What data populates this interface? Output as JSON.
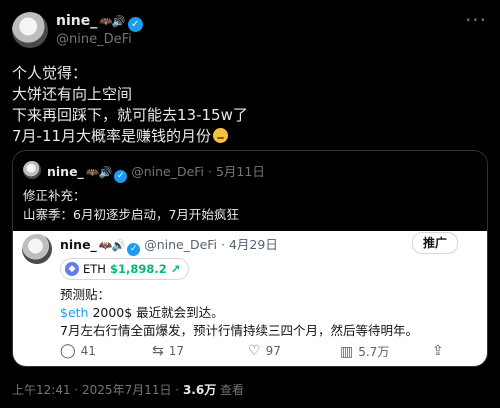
{
  "post": {
    "author_name": "nine_",
    "author_emojis": "🦇🔊",
    "author_handle": "@nine_DeFi",
    "more": "···",
    "lines": [
      "个人觉得：",
      "大饼还有向上空间",
      "下来再回踩下，就可能去13-15w了",
      "7月-11月大概率是赚钱的月份"
    ],
    "time": "上午12:41 · 2025年7月11日 ·",
    "views_count": "3.6万",
    "views_label": "查看"
  },
  "quote": {
    "author_name": "nine_",
    "author_emojis": "🦇🔊",
    "author_handle": "@nine_DeFi",
    "date": "· 5月11日",
    "line1": "修正补充：",
    "line2": "山寨季：6月初逐步启动，7月开始疯狂"
  },
  "inner": {
    "author_name": "nine_",
    "author_emojis": "🦇🔊",
    "author_handle": "@nine_DeFi",
    "date": "· 4月29日",
    "promo": "推广",
    "eth_symbol": "ETH",
    "eth_price": "$1,898.2",
    "eth_arrow": "↗",
    "line1": "预测贴：",
    "line2_tag": "$eth",
    "line2_rest": " 2000$ 最近就会到达。",
    "line3": "7月左右行情全面爆发，预计行情持续三四个月，然后等待明年。",
    "replies": "41",
    "reposts": "17",
    "likes": "97",
    "views": "5.7万"
  },
  "colors": {
    "accent": "#1d9bf0",
    "eth": "#627eea",
    "up": "#00ba7c"
  }
}
